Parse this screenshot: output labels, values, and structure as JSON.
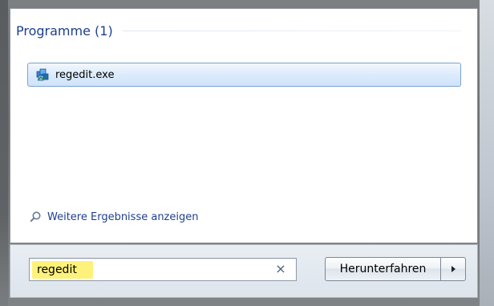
{
  "results": {
    "group_title": "Programme (1)",
    "items": [
      {
        "label": "regedit.exe",
        "icon": "registry-editor-icon"
      }
    ],
    "more_results_label": "Weitere Ergebnisse anzeigen"
  },
  "search": {
    "value": "regedit",
    "clear_label": "×",
    "highlight_color": "#fff27a"
  },
  "shutdown": {
    "label": "Herunterfahren",
    "arrow_icon": "triangle-right-icon"
  },
  "colors": {
    "link_blue": "#1f3f8f",
    "selection_border": "#7da2ce"
  }
}
